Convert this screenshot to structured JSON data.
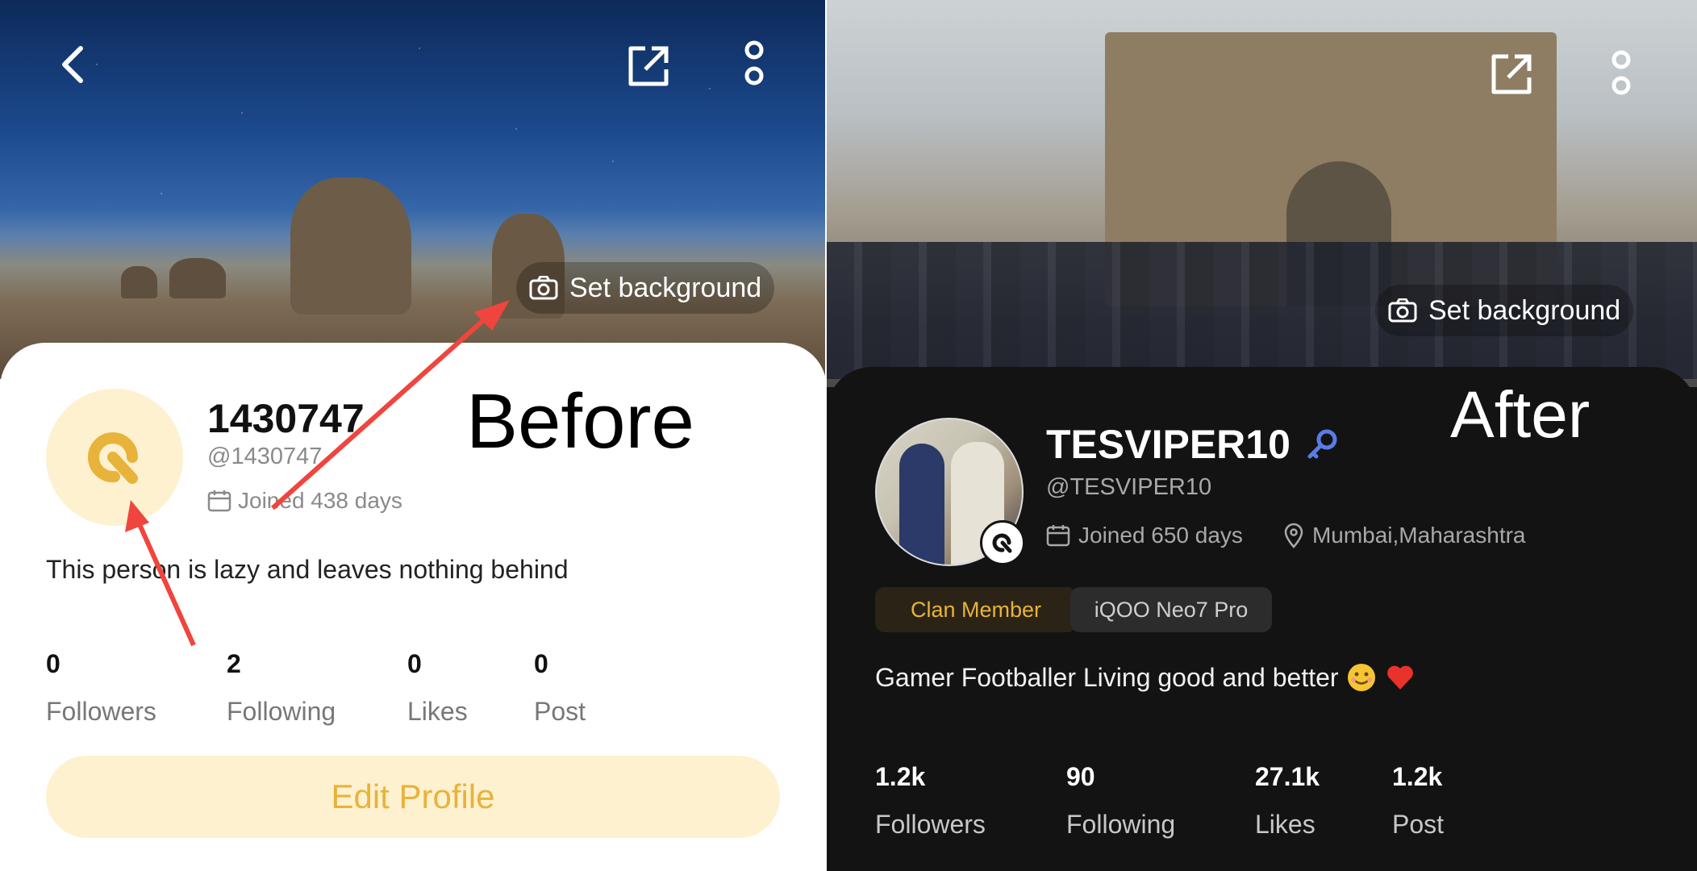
{
  "before": {
    "label": "Before",
    "set_background": "Set background",
    "profile": {
      "name": "1430747",
      "handle": "@1430747",
      "joined": "Joined 438 days",
      "bio": "This person is lazy and leaves nothing behind"
    },
    "stats": [
      {
        "value": "0",
        "label": "Followers"
      },
      {
        "value": "2",
        "label": "Following"
      },
      {
        "value": "0",
        "label": "Likes"
      },
      {
        "value": "0",
        "label": "Post"
      }
    ],
    "edit_profile": "Edit Profile",
    "colors": {
      "accent": "#e8b33a",
      "avatar_bg": "#fdf1cf",
      "arrow": "#f0453e"
    }
  },
  "after": {
    "label": "After",
    "set_background": "Set background",
    "profile": {
      "name": "TESVIPER10",
      "handle": "@TESVIPER10",
      "joined": "Joined 650 days",
      "location": "Mumbai,Maharashtra",
      "bio": "Gamer Footballer Living good and better",
      "bio_emojis": [
        "smiling-face",
        "red-heart"
      ]
    },
    "tags": [
      "Clan Member",
      "iQOO Neo7 Pro"
    ],
    "stats": [
      {
        "value": "1.2k",
        "label": "Followers"
      },
      {
        "value": "90",
        "label": "Following"
      },
      {
        "value": "27.1k",
        "label": "Likes"
      },
      {
        "value": "1.2k",
        "label": "Post"
      }
    ],
    "colors": {
      "background": "#131313",
      "verified": "#5b7be8",
      "clan": "#e8b33a"
    }
  },
  "icons": [
    "back-icon",
    "share-icon",
    "more-icon",
    "camera-icon",
    "calendar-icon",
    "location-icon",
    "verified-key-icon"
  ]
}
